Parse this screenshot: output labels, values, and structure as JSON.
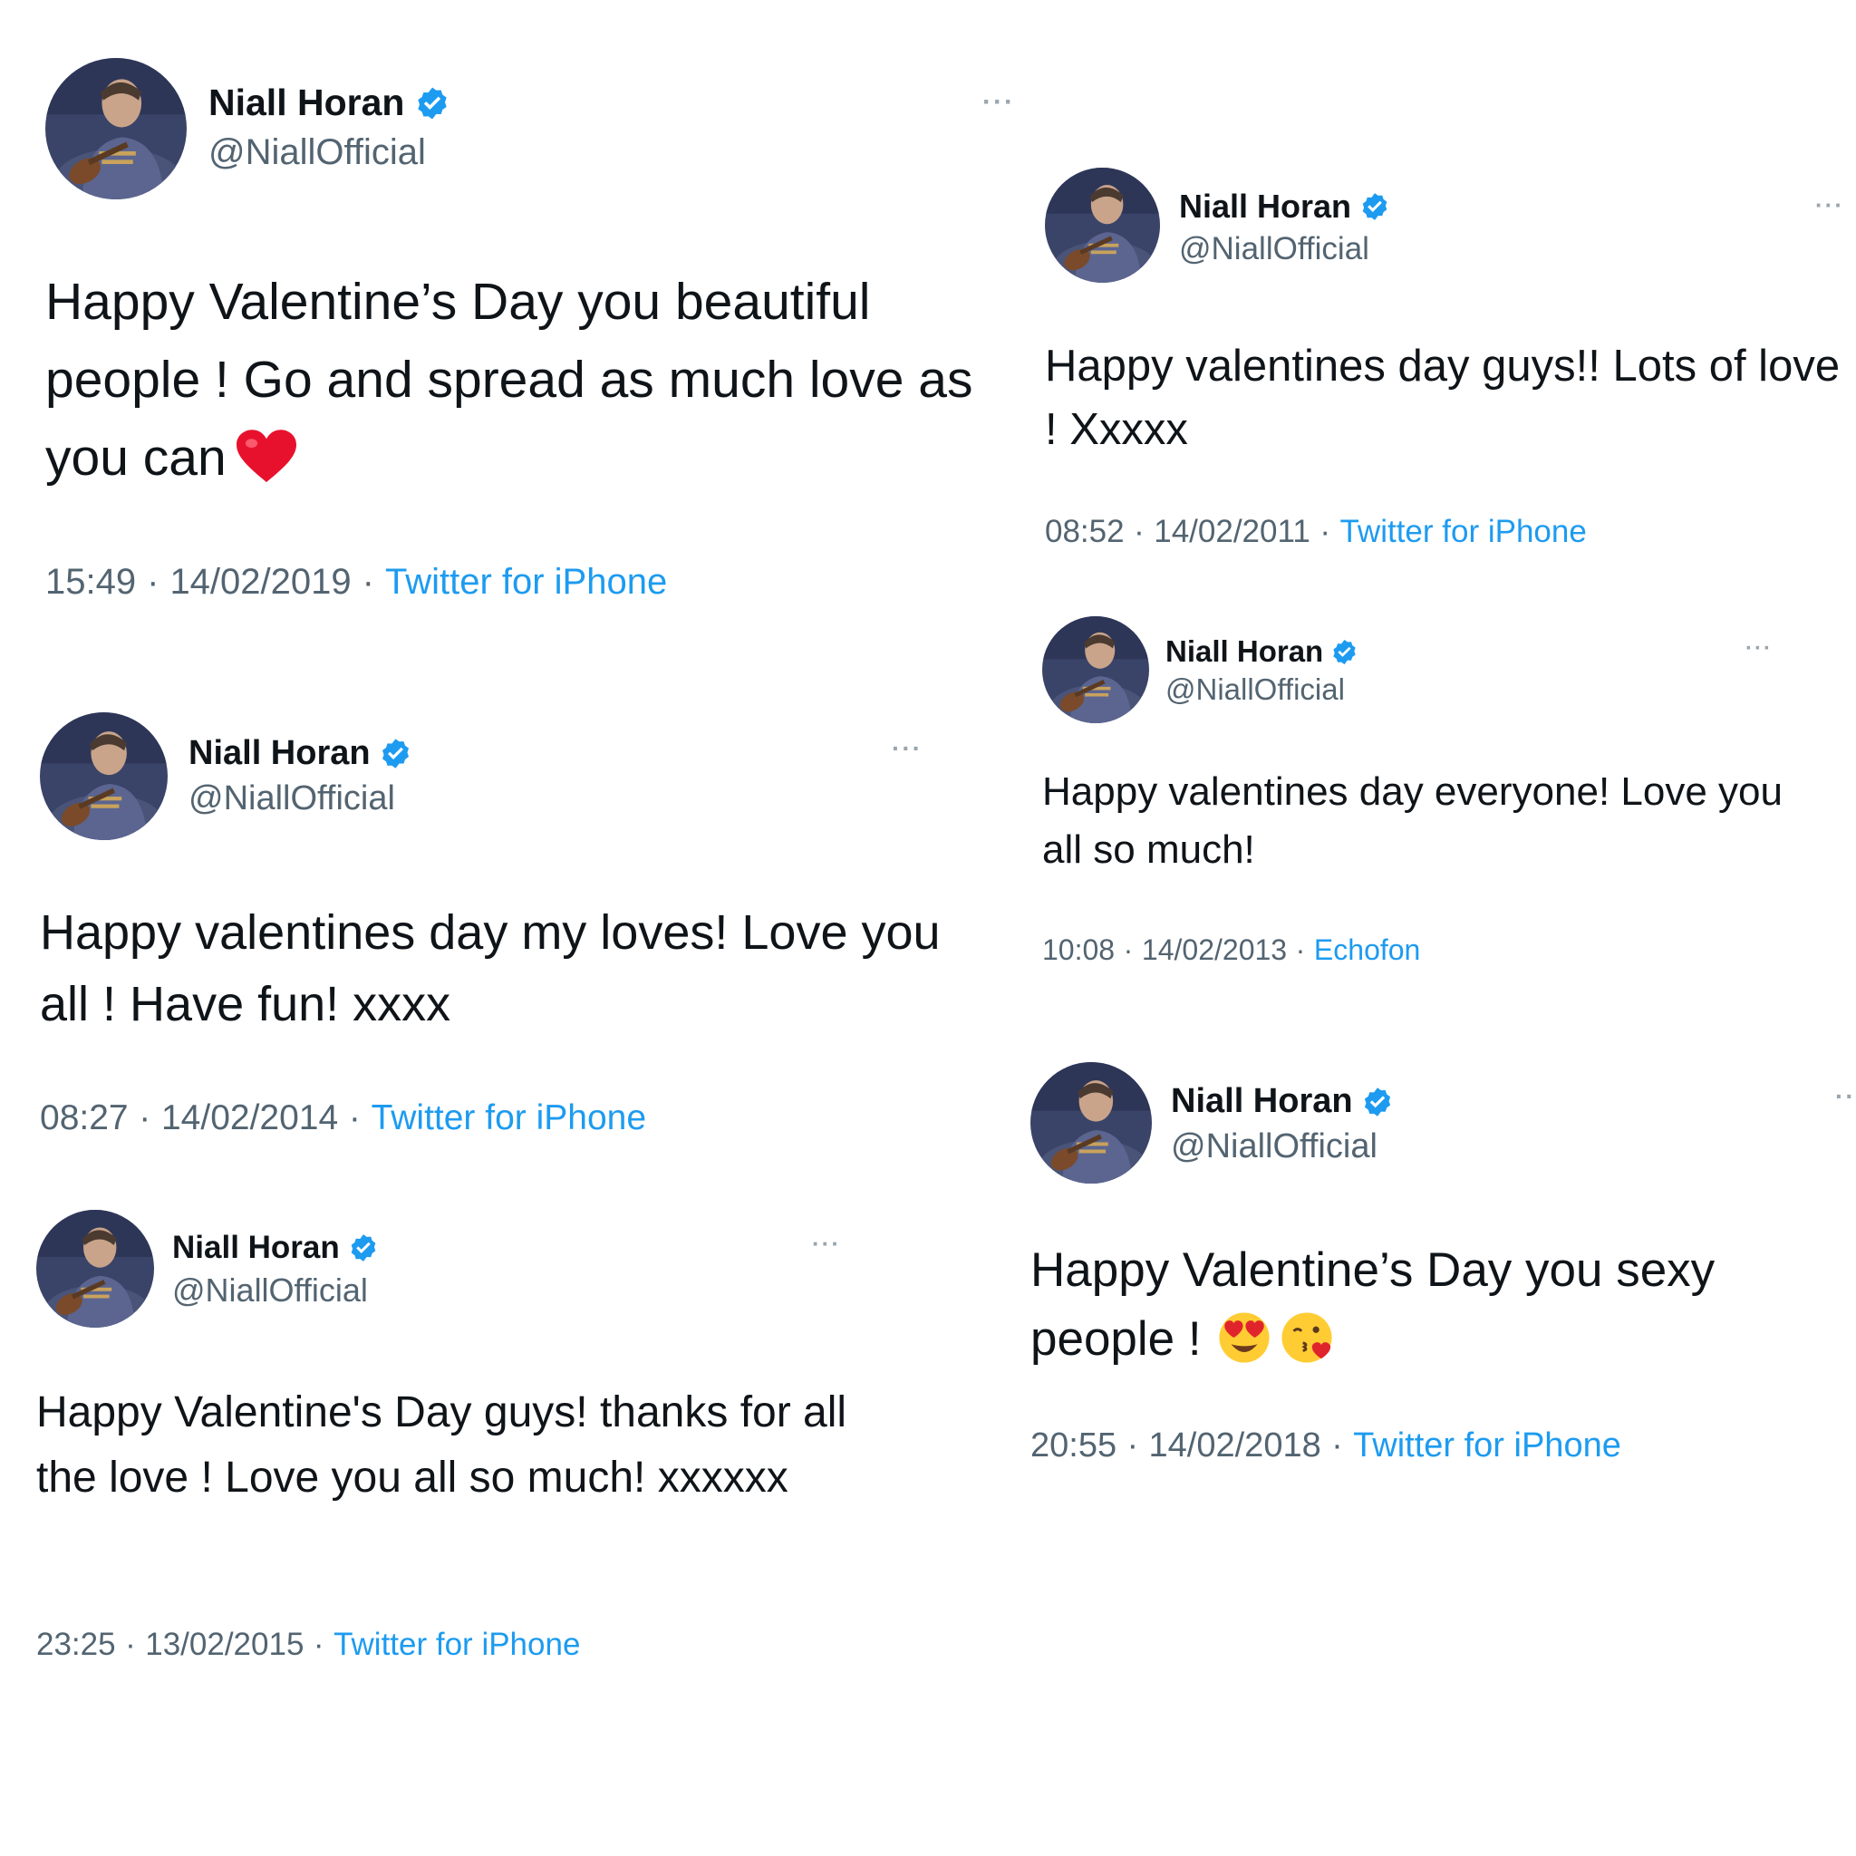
{
  "colors": {
    "verified": "#1d9bf0",
    "text": "#0f1419",
    "muted": "#536471",
    "link": "#1d9bf0"
  },
  "tweets": [
    {
      "name": "Niall Horan",
      "handle": "@NiallOfficial",
      "text": "Happy Valentine’s Day you beautiful people ! Go and spread as much love as you can",
      "emojis": [
        "red-heart"
      ],
      "time": "15:49",
      "date": "14/02/2019",
      "source": "Twitter for iPhone"
    },
    {
      "name": "Niall Horan",
      "handle": "@NiallOfficial",
      "text": "Happy valentines day guys!! Lots of love ! Xxxxx",
      "emojis": [],
      "time": "08:52",
      "date": "14/02/2011",
      "source": "Twitter for iPhone"
    },
    {
      "name": "Niall Horan",
      "handle": "@NiallOfficial",
      "text": "Happy valentines day everyone! Love you all so much!",
      "emojis": [],
      "time": "10:08",
      "date": "14/02/2013",
      "source": "Echofon"
    },
    {
      "name": "Niall Horan",
      "handle": "@NiallOfficial",
      "text": "Happy valentines day my loves! Love you all ! Have fun! xxxx",
      "emojis": [],
      "time": "08:27",
      "date": "14/02/2014",
      "source": "Twitter for iPhone"
    },
    {
      "name": "Niall Horan",
      "handle": "@NiallOfficial",
      "text": "Happy Valentine’s Day you sexy people !",
      "emojis": [
        "heart-eyes",
        "kissing-heart"
      ],
      "time": "20:55",
      "date": "14/02/2018",
      "source": "Twitter for iPhone"
    },
    {
      "name": "Niall Horan",
      "handle": "@NiallOfficial",
      "text": "Happy Valentine's Day guys! thanks for all the love ! Love you all so much! xxxxxx",
      "emojis": [],
      "time": "23:25",
      "date": "13/02/2015",
      "source": "Twitter for iPhone"
    }
  ]
}
